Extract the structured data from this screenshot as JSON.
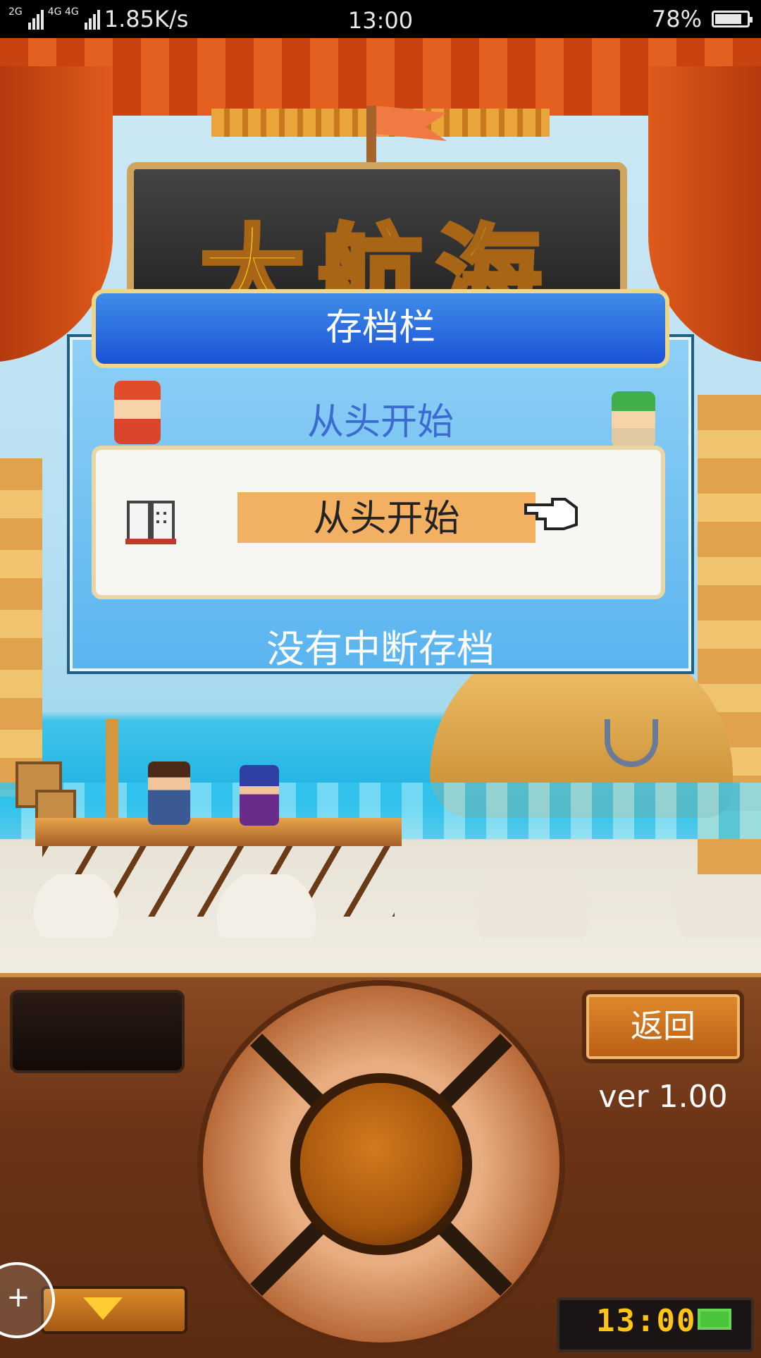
{
  "status_bar": {
    "signal_left": "2G",
    "signal_mid": "4G 4G",
    "speed": "1.85K/s",
    "time": "13:00",
    "battery": "78%"
  },
  "game": {
    "logo_text": "大航海"
  },
  "dialog": {
    "title": "存档栏",
    "subtitle": "从头开始",
    "slot_label": "从头开始",
    "status": "没有中断存档"
  },
  "controls": {
    "back_label": "返回",
    "version": "ver 1.00",
    "clock": "13:00"
  },
  "icons": {
    "book": "book-icon",
    "hand": "pointing-hand-icon",
    "down": "down-arrow-icon",
    "gamepad": "gamepad-add-icon",
    "battery": "battery-icon"
  },
  "colors": {
    "dialog_header": "#1b52d6",
    "dialog_body": "#5ab4ef",
    "slot_highlight": "#f2b062",
    "clock": "#ffc414"
  }
}
